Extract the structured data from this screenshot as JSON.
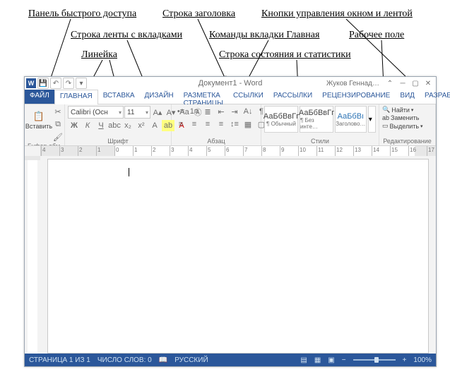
{
  "annotations": {
    "qat": "Панель быстрого доступа",
    "titlebar": "Строка заголовка",
    "winbtns": "Кнопки управления окном и лентой",
    "tabstrip": "Строка ленты с вкладками",
    "hometab_cmds": "Команды вкладки Главная",
    "workarea": "Рабочее поле",
    "ruler": "Линейка",
    "statusbar": "Строка состояния и статистики"
  },
  "titlebar": {
    "doc_title": "Документ1 - Word",
    "user": "Жуков Геннад…"
  },
  "tabs": {
    "file": "ФАЙЛ",
    "home": "ГЛАВНАЯ",
    "insert": "ВСТАВКА",
    "design": "ДИЗАЙН",
    "layout": "РАЗМЕТКА СТРАНИЦЫ",
    "references": "ССЫЛКИ",
    "mailings": "РАССЫЛКИ",
    "review": "РЕЦЕНЗИРОВАНИЕ",
    "view": "ВИД",
    "developer": "РАЗРАБОТЧИК"
  },
  "ribbon": {
    "clipboard": {
      "label": "Буфер обм…",
      "paste": "Вставить"
    },
    "font": {
      "label": "Шрифт",
      "name": "Calibri (Осн",
      "size": "11"
    },
    "paragraph": {
      "label": "Абзац"
    },
    "styles": {
      "label": "Стили",
      "items": [
        {
          "sample": "АаБбВвГг",
          "name": "¶ Обычный"
        },
        {
          "sample": "АаБбВвГг",
          "name": "¶ Без инте…"
        },
        {
          "sample": "АаБбВı",
          "name": "Заголово…"
        }
      ]
    },
    "editing": {
      "label": "Редактирование",
      "find": "Найти",
      "replace": "Заменить",
      "select": "Выделить"
    }
  },
  "status": {
    "page": "СТРАНИЦА 1 ИЗ 1",
    "words": "ЧИСЛО СЛОВ: 0",
    "lang": "РУССКИЙ",
    "zoom": "100%"
  }
}
